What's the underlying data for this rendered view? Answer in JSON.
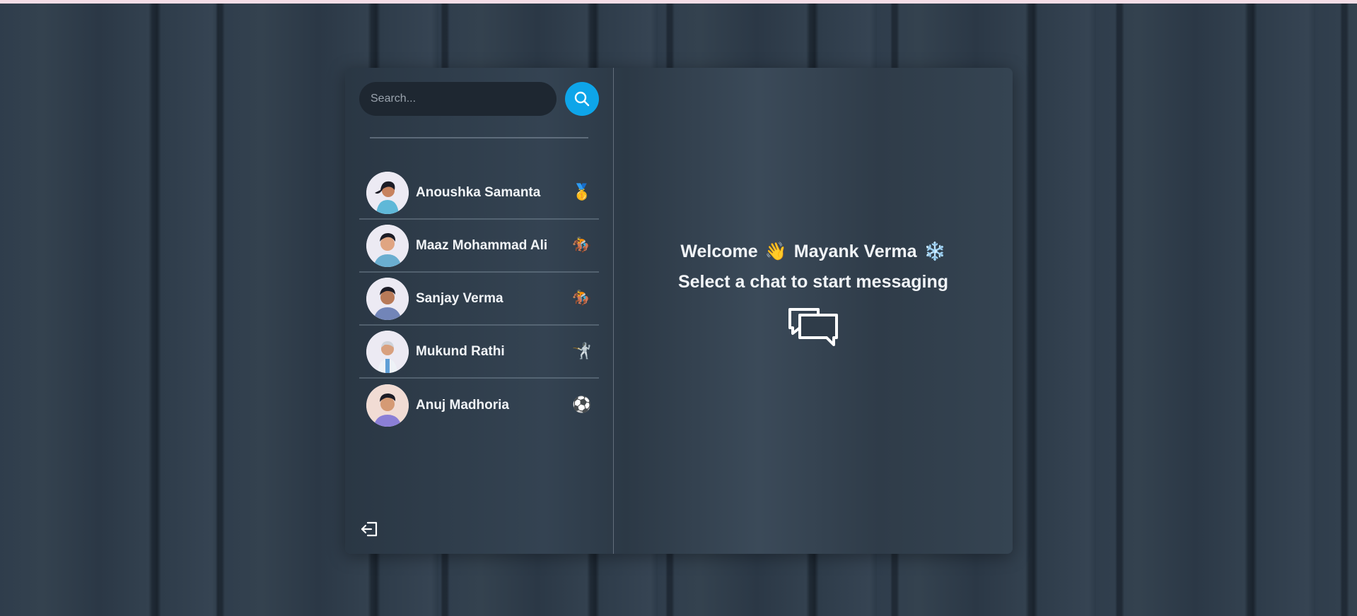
{
  "search": {
    "placeholder": "Search..."
  },
  "users": [
    {
      "name": "Anoushka Samanta",
      "emoji": "🥇",
      "emoji_icon": "medal-icon"
    },
    {
      "name": "Maaz Mohammad Ali",
      "emoji": "🏇",
      "emoji_icon": "horse-racing-icon"
    },
    {
      "name": "Sanjay Verma",
      "emoji": "🏇",
      "emoji_icon": "horse-racing-icon"
    },
    {
      "name": "Mukund Rathi",
      "emoji": "🤺",
      "emoji_icon": "fencing-icon"
    },
    {
      "name": "Anuj Madhoria",
      "emoji": "⚽",
      "emoji_icon": "soccer-ball-icon"
    }
  ],
  "welcome": {
    "greeting": "Welcome",
    "wave_emoji": "👋",
    "username": "Mayank Verma",
    "snow_emoji": "❄️",
    "prompt": "Select a chat to start messaging"
  },
  "colors": {
    "accent": "#0ea5e9",
    "panel_text": "#f1f4f7",
    "input_bg": "#1e2731"
  }
}
